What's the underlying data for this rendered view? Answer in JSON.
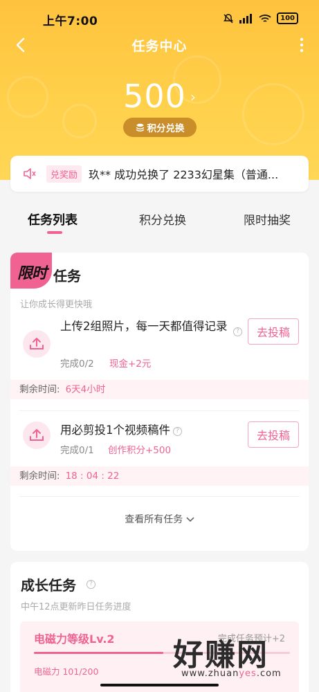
{
  "status": {
    "time": "上午7:00",
    "battery": "100"
  },
  "nav": {
    "title": "任务中心"
  },
  "points": {
    "value": "500",
    "arrow": "›",
    "exchange_label": "积分兑换"
  },
  "notice": {
    "badge": "兑奖励",
    "text": "玖** 成功兑换了 2233幻星集（普通..."
  },
  "tabs": [
    {
      "label": "任务列表",
      "active": true
    },
    {
      "label": "积分兑换",
      "active": false
    },
    {
      "label": "限时抽奖",
      "active": false
    }
  ],
  "limited": {
    "badge_text": "限时",
    "title": "任务",
    "subtitle": "让你成长得更快哦",
    "tasks": [
      {
        "title": "上传2组照片，每一天都值得记录",
        "progress": "完成0/2",
        "reward": "现金+2元",
        "button": "去投稿",
        "remain_label": "剩余时间:",
        "remain_value": "6天4小时"
      },
      {
        "title": "用必剪投1个视频稿件",
        "progress": "完成0/1",
        "reward": "创作积分+500",
        "button": "去投稿",
        "remain_label": "剩余时间:",
        "remain_value": "18 : 04 : 22"
      }
    ],
    "view_all": "查看所有任务"
  },
  "growth": {
    "title": "成长任务",
    "subtitle": "中午12点更新昨日任务进度",
    "level_title": "电磁力等级Lv.2",
    "level_estimate": "完成任务预计+2",
    "level_value": "电磁力 101/200",
    "level_progress": 0.505
  },
  "watermark": {
    "text": "好赚网",
    "url_pre": "www.zhuan",
    "url_mid": "yes",
    "url_post": ".com"
  },
  "colors": {
    "accent": "#f06292",
    "hero_top": "#ffc23e",
    "hero_bottom": "#ffd656",
    "pill": "#c98d2a"
  }
}
